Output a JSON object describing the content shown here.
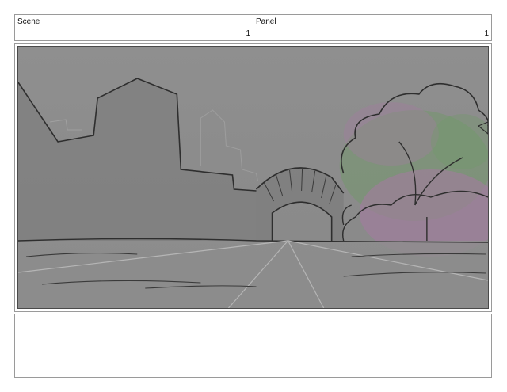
{
  "header": {
    "scene": {
      "label": "Scene",
      "value": "1"
    },
    "panel": {
      "label": "Panel",
      "value": "1"
    }
  },
  "frame": {
    "background_color": "#8a8a8a",
    "accent_green": "#6f9a66",
    "accent_purple": "#a67aa3"
  },
  "notes": {
    "text": ""
  }
}
